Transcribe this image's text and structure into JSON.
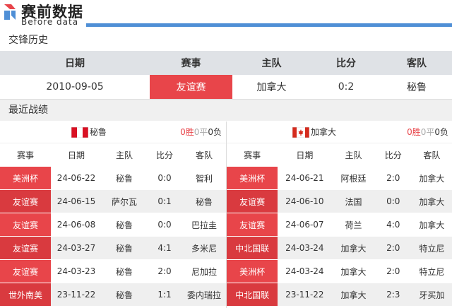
{
  "header": {
    "logo_cn": "赛前数据",
    "logo_en": "Before data"
  },
  "h2h": {
    "section_title": "交锋历史",
    "columns": [
      "日期",
      "赛事",
      "主队",
      "比分",
      "客队"
    ],
    "rows": [
      {
        "date": "2010-09-05",
        "event": "友谊赛",
        "home": "加拿大",
        "score": "0:2",
        "away": "秘鲁"
      }
    ]
  },
  "recent": {
    "section_title": "最近战绩",
    "columns": [
      "赛事",
      "日期",
      "主队",
      "比分",
      "客队"
    ],
    "left": {
      "team": "秘鲁",
      "flag_icon": "peru-flag-icon",
      "record": {
        "wins": "0胜",
        "draws": "0平",
        "losses": "0负"
      },
      "rows": [
        {
          "event": "美洲杯",
          "date": "24-06-22",
          "home": "秘鲁",
          "score": "0:0",
          "away": "智利"
        },
        {
          "event": "友谊赛",
          "date": "24-06-15",
          "home": "萨尔瓦",
          "score": "0:1",
          "away": "秘鲁"
        },
        {
          "event": "友谊赛",
          "date": "24-06-08",
          "home": "秘鲁",
          "score": "0:0",
          "away": "巴拉圭"
        },
        {
          "event": "友谊赛",
          "date": "24-03-27",
          "home": "秘鲁",
          "score": "4:1",
          "away": "多米尼"
        },
        {
          "event": "友谊赛",
          "date": "24-03-23",
          "home": "秘鲁",
          "score": "2:0",
          "away": "尼加拉"
        },
        {
          "event": "世外南美",
          "date": "23-11-22",
          "home": "秘鲁",
          "score": "1:1",
          "away": "委内瑞拉"
        }
      ]
    },
    "right": {
      "team": "加拿大",
      "flag_icon": "canada-flag-icon",
      "record": {
        "wins": "0胜",
        "draws": "0平",
        "losses": "0负"
      },
      "rows": [
        {
          "event": "美洲杯",
          "date": "24-06-21",
          "home": "阿根廷",
          "score": "2:0",
          "away": "加拿大"
        },
        {
          "event": "友谊赛",
          "date": "24-06-10",
          "home": "法国",
          "score": "0:0",
          "away": "加拿大"
        },
        {
          "event": "友谊赛",
          "date": "24-06-07",
          "home": "荷兰",
          "score": "4:0",
          "away": "加拿大"
        },
        {
          "event": "中北国联",
          "date": "24-03-24",
          "home": "加拿大",
          "score": "2:0",
          "away": "特立尼"
        },
        {
          "event": "美洲杯",
          "date": "24-03-24",
          "home": "加拿大",
          "score": "2:0",
          "away": "特立尼"
        },
        {
          "event": "中北国联",
          "date": "23-11-22",
          "home": "加拿大",
          "score": "2:3",
          "away": "牙买加"
        }
      ]
    }
  },
  "colors": {
    "accent_red": "#e8454a",
    "header_blue": "#4f8fd6",
    "header_grey": "#dfe2e6"
  }
}
